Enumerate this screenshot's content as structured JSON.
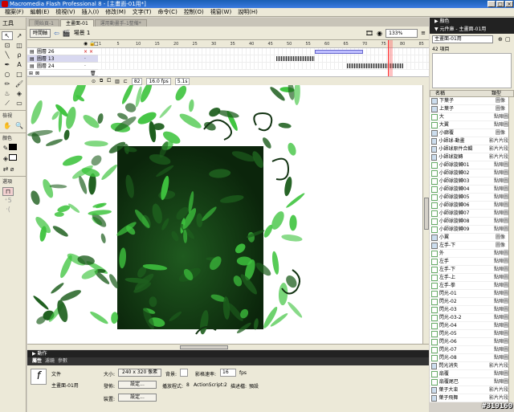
{
  "app": {
    "title": "Macromedia Flash Professional 8 - [主畫面-01用*]",
    "window_buttons": [
      "_",
      "□",
      "×"
    ]
  },
  "menu": [
    "檔案(F)",
    "編輯(E)",
    "檢視(V)",
    "插入(I)",
    "修改(M)",
    "文字(T)",
    "命令(C)",
    "控制(O)",
    "視窗(W)",
    "說明(H)"
  ],
  "tools": {
    "title": "工具",
    "view_label": "檢視",
    "colors_label": "顏色",
    "options_label": "選項"
  },
  "doc_tabs": [
    "開始頁-1",
    "主畫面-01",
    "運用動畫手-1整備*"
  ],
  "editbar": {
    "timeline_button": "時間軸",
    "scene": "場景 1",
    "zoom": "133%"
  },
  "timeline": {
    "ticks": [
      "1",
      "5",
      "10",
      "15",
      "20",
      "25",
      "30",
      "35",
      "40",
      "45",
      "50",
      "55",
      "60",
      "65",
      "70",
      "75",
      "80",
      "85"
    ],
    "layers": [
      {
        "name": "圖層 26"
      },
      {
        "name": "圖層 13"
      },
      {
        "name": "圖層 24"
      }
    ],
    "status": {
      "frame": "82",
      "fps": "16.0 fps",
      "time": "5.1s"
    }
  },
  "panels": {
    "actions": "▶ 動作",
    "props_tabs": [
      "屬性",
      "濾鏡",
      "參數"
    ],
    "props": {
      "kind": "文件",
      "doc_name": "主畫面-01用",
      "size_label": "大小:",
      "size_value": "240 x 320 像素",
      "bg_label": "背景:",
      "fps_label": "影格速率:",
      "fps_value": "16",
      "fps_unit": "fps",
      "publish_label": "發佈:",
      "settings_btn": "設定...",
      "player_label": "播放程式:",
      "player_value": "8",
      "as_label": "ActionScript:",
      "as_value": "2",
      "profile_label": "描述檔:",
      "profile_value": "預設",
      "device_label": "裝置:",
      "device_btn": "設定..."
    }
  },
  "right": {
    "color_bar": "▶ 顏色",
    "lib_bar": "▼ 元件庫 - 主畫面-01用",
    "lib_select": "主畫面-01用",
    "lib_count": "42 項目",
    "col_name": "名稱",
    "col_type": "類型",
    "items": [
      {
        "name": "下葉子",
        "type": "圖像"
      },
      {
        "name": "上葉子",
        "type": "圖像"
      },
      {
        "name": "大",
        "type": "點陣圖"
      },
      {
        "name": "大翼",
        "type": "點陣圖"
      },
      {
        "name": "小廊覆",
        "type": "圖像"
      },
      {
        "name": "小師球-動畫",
        "type": "影片片段"
      },
      {
        "name": "小師球原件合輯",
        "type": "影片片段"
      },
      {
        "name": "小師球旋轉",
        "type": "影片片段"
      },
      {
        "name": "小師球旋轉01",
        "type": "點陣圖"
      },
      {
        "name": "小師球旋轉02",
        "type": "點陣圖"
      },
      {
        "name": "小師球旋轉03",
        "type": "點陣圖"
      },
      {
        "name": "小師球旋轉04",
        "type": "點陣圖"
      },
      {
        "name": "小師球旋轉05",
        "type": "點陣圖"
      },
      {
        "name": "小師球旋轉06",
        "type": "點陣圖"
      },
      {
        "name": "小師球旋轉07",
        "type": "點陣圖"
      },
      {
        "name": "小師球旋轉08",
        "type": "點陣圖"
      },
      {
        "name": "小師球旋轉09",
        "type": "點陣圖"
      },
      {
        "name": "小翼",
        "type": "圖像"
      },
      {
        "name": "左手-下",
        "type": "圖像"
      },
      {
        "name": "外",
        "type": "點陣圖"
      },
      {
        "name": "左手",
        "type": "點陣圖"
      },
      {
        "name": "左手-下",
        "type": "點陣圖"
      },
      {
        "name": "左手-上",
        "type": "點陣圖"
      },
      {
        "name": "左手-拳",
        "type": "點陣圖"
      },
      {
        "name": "閃光-01",
        "type": "點陣圖"
      },
      {
        "name": "閃光-02",
        "type": "點陣圖"
      },
      {
        "name": "閃光-03",
        "type": "點陣圖"
      },
      {
        "name": "閃光-03-2",
        "type": "點陣圖"
      },
      {
        "name": "閃光-04",
        "type": "點陣圖"
      },
      {
        "name": "閃光-05",
        "type": "點陣圖"
      },
      {
        "name": "閃光-06",
        "type": "點陣圖"
      },
      {
        "name": "閃光-07",
        "type": "點陣圖"
      },
      {
        "name": "閃光-08",
        "type": "點陣圖"
      },
      {
        "name": "閃光消失",
        "type": "影片片段"
      },
      {
        "name": "扇覆",
        "type": "點陣圖"
      },
      {
        "name": "扇覆尾巴",
        "type": "點陣圖"
      },
      {
        "name": "葉子大束",
        "type": "影片片段"
      },
      {
        "name": "葉子飛舞",
        "type": "影片片段"
      }
    ]
  },
  "watermark": "#319160",
  "colors": {
    "stage_dark": "#0d2a0d",
    "leaf_light": "#3fc43f",
    "leaf_dark": "#1d5e1d",
    "accent_blue": "#2a5fb8"
  }
}
